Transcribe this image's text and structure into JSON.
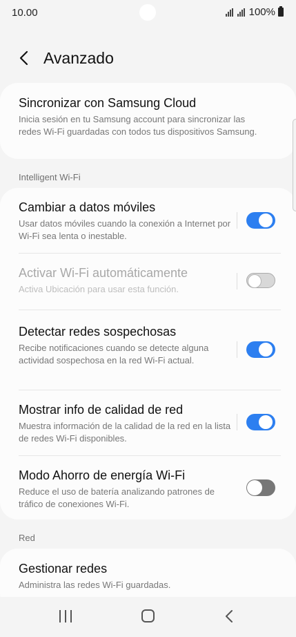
{
  "status_bar": {
    "time": "10.00",
    "battery": "100%"
  },
  "header": {
    "title": "Avanzado"
  },
  "cloud": {
    "title": "Sincronizar con Samsung Cloud",
    "subtitle": "Inicia sesión en tu Samsung account para sincronizar las redes Wi-Fi guardadas con todos tus dispositivos Samsung."
  },
  "intelligent": {
    "label": "Intelligent Wi-Fi",
    "items": [
      {
        "title": "Cambiar a datos móviles",
        "subtitle": "Usar datos móviles cuando la conexión a Internet por Wi-Fi sea lenta o inestable.",
        "on": true,
        "enabled": true
      },
      {
        "title": "Activar Wi-Fi automáticamente",
        "subtitle": "Activa Ubicación para usar esta función.",
        "on": false,
        "enabled": false
      },
      {
        "title": "Detectar redes sospechosas",
        "subtitle": "Recibe notificaciones cuando se detecte alguna actividad sospechosa en la red Wi-Fi actual.",
        "on": true,
        "enabled": true
      },
      {
        "title": "Mostrar info de calidad de red",
        "subtitle": "Muestra información de la calidad de la red en la lista de redes Wi-Fi disponibles.",
        "on": true,
        "enabled": true
      },
      {
        "title": "Modo Ahorro de energía Wi-Fi",
        "subtitle": "Reduce el uso de batería analizando patrones de tráfico de conexiones Wi-Fi.",
        "on": false,
        "enabled": true
      }
    ]
  },
  "red": {
    "label": "Red",
    "item": {
      "title": "Gestionar redes",
      "subtitle": "Administra las redes Wi-Fi guardadas."
    }
  },
  "colors": {
    "accent": "#2d7ff0",
    "background": "#f4f4f4",
    "card": "#fcfcfc"
  }
}
